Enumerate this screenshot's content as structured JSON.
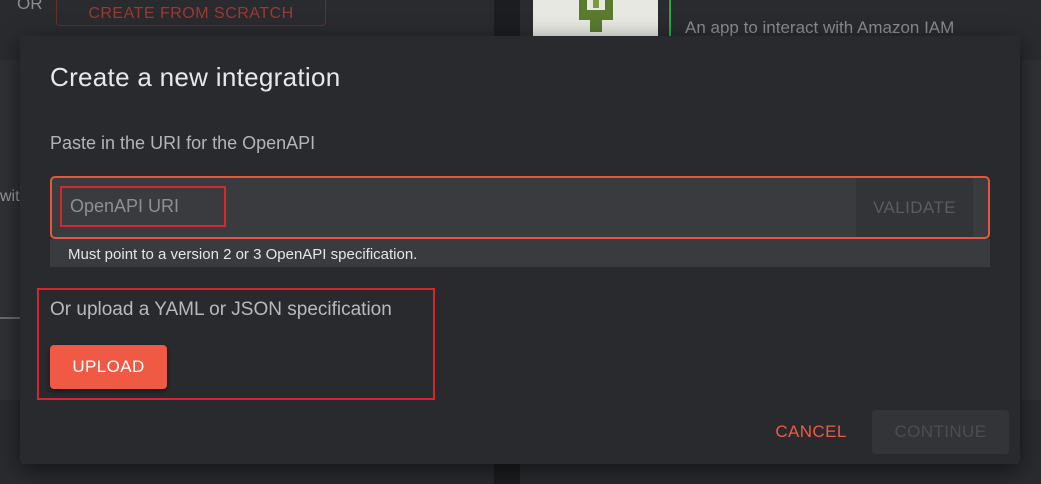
{
  "background": {
    "or_label": "OR",
    "create_from_scratch_label": "CREATE FROM SCRATCH",
    "partial_text": "with",
    "app_description": "An app to interact with Amazon IAM",
    "app_icon": "wrench-icon"
  },
  "dialog": {
    "title": "Create a new integration",
    "uri_section": {
      "label": "Paste in the URI for the OpenAPI",
      "input_placeholder": "OpenAPI URI",
      "input_value": "",
      "validate_label": "VALIDATE",
      "helper_text": "Must point to a version 2 or 3 OpenAPI specification."
    },
    "upload_section": {
      "label": "Or upload a YAML or JSON specification",
      "upload_label": "UPLOAD"
    },
    "actions": {
      "cancel_label": "CANCEL",
      "continue_label": "CONTINUE"
    }
  },
  "colors": {
    "accent": "#f05a44",
    "highlight": "#d7262e",
    "modal_bg": "#292a2e"
  }
}
